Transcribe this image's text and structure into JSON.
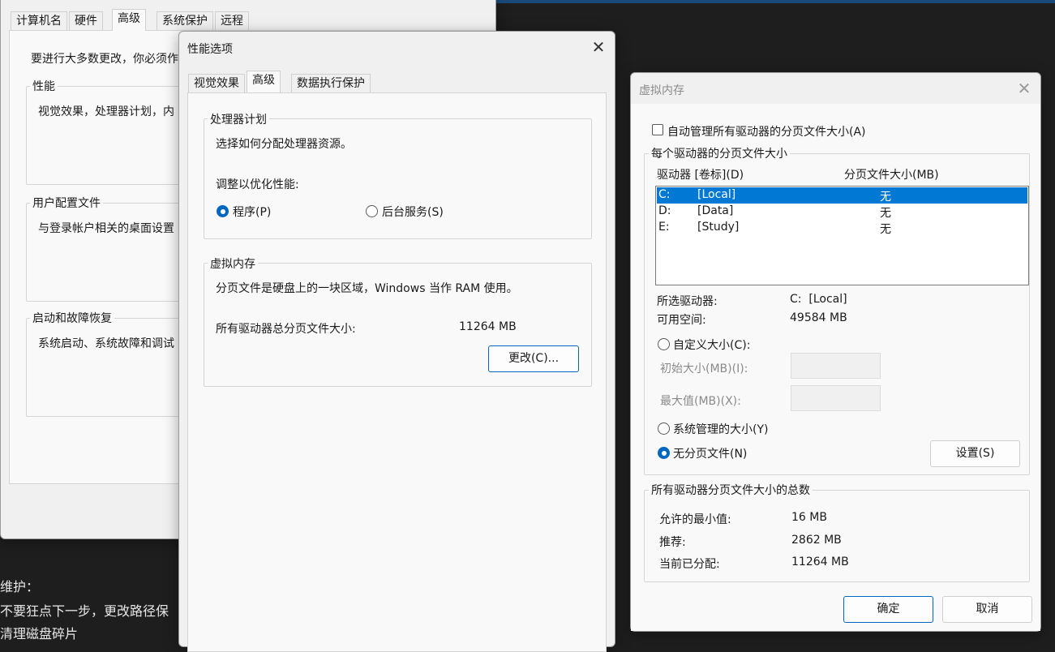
{
  "background": {
    "dark_lines": [
      "维护：",
      "不要狂点下一步，更改路径保",
      "清理磁盘碎片"
    ]
  },
  "system_properties": {
    "tabs": [
      "计算机名",
      "硬件",
      "高级",
      "系统保护",
      "远程"
    ],
    "active_tab": "高级",
    "intro": "要进行大多数更改，你必须作",
    "groups": [
      {
        "title": "性能",
        "desc": "视觉效果，处理器计划，内"
      },
      {
        "title": "用户配置文件",
        "desc": "与登录帐户相关的桌面设置"
      },
      {
        "title": "启动和故障恢复",
        "desc": "系统启动、系统故障和调试"
      }
    ]
  },
  "performance_options": {
    "title": "性能选项",
    "close_label": "✕",
    "tabs": [
      "视觉效果",
      "高级",
      "数据执行保护"
    ],
    "active_tab": "高级",
    "cpu": {
      "title": "处理器计划",
      "desc": "选择如何分配处理器资源。",
      "adjust_label": "调整以优化性能:",
      "options": [
        {
          "label": "程序(P)",
          "checked": true
        },
        {
          "label": "后台服务(S)",
          "checked": false
        }
      ]
    },
    "vm": {
      "title": "虚拟内存",
      "desc": "分页文件是硬盘上的一块区域，Windows 当作 RAM 使用。",
      "total_label": "所有驱动器总分页文件大小:",
      "total_value": "11264 MB",
      "change_button": "更改(C)..."
    }
  },
  "virtual_memory": {
    "title": "虚拟内存",
    "close_label": "✕",
    "auto_manage_label": "自动管理所有驱动器的分页文件大小(A)",
    "auto_manage_checked": false,
    "per_drive_group": "每个驱动器的分页文件大小",
    "columns": [
      "驱动器 [卷标](D)",
      "分页文件大小(MB)"
    ],
    "drives": [
      {
        "drive": "C:",
        "label": "[Local]",
        "size": "无",
        "selected": true
      },
      {
        "drive": "D:",
        "label": "[Data]",
        "size": "无",
        "selected": false
      },
      {
        "drive": "E:",
        "label": "[Study]",
        "size": "无",
        "selected": false
      }
    ],
    "selected_drive_label": "所选驱动器:",
    "selected_drive_value": "C:  [Local]",
    "free_space_label": "可用空间:",
    "free_space_value": "49584 MB",
    "custom_size_label": "自定义大小(C):",
    "initial_size_label": "初始大小(MB)(I):",
    "max_size_label": "最大值(MB)(X):",
    "initial_size_value": "",
    "max_size_value": "",
    "system_managed_label": "系统管理的大小(Y)",
    "no_paging_label": "无分页文件(N)",
    "selected_option": "no_paging",
    "set_button": "设置(S)",
    "totals_group": "所有驱动器分页文件大小的总数",
    "min_allowed_label": "允许的最小值:",
    "min_allowed_value": "16 MB",
    "recommended_label": "推荐:",
    "recommended_value": "2862 MB",
    "current_label": "当前已分配:",
    "current_value": "11264 MB",
    "ok_button": "确定",
    "cancel_button": "取消"
  },
  "colors": {
    "accent": "#0067c0",
    "selection": "#0078d4",
    "window_bg": "#f0f0f0",
    "desktop_bg": "#1e1e1e"
  }
}
